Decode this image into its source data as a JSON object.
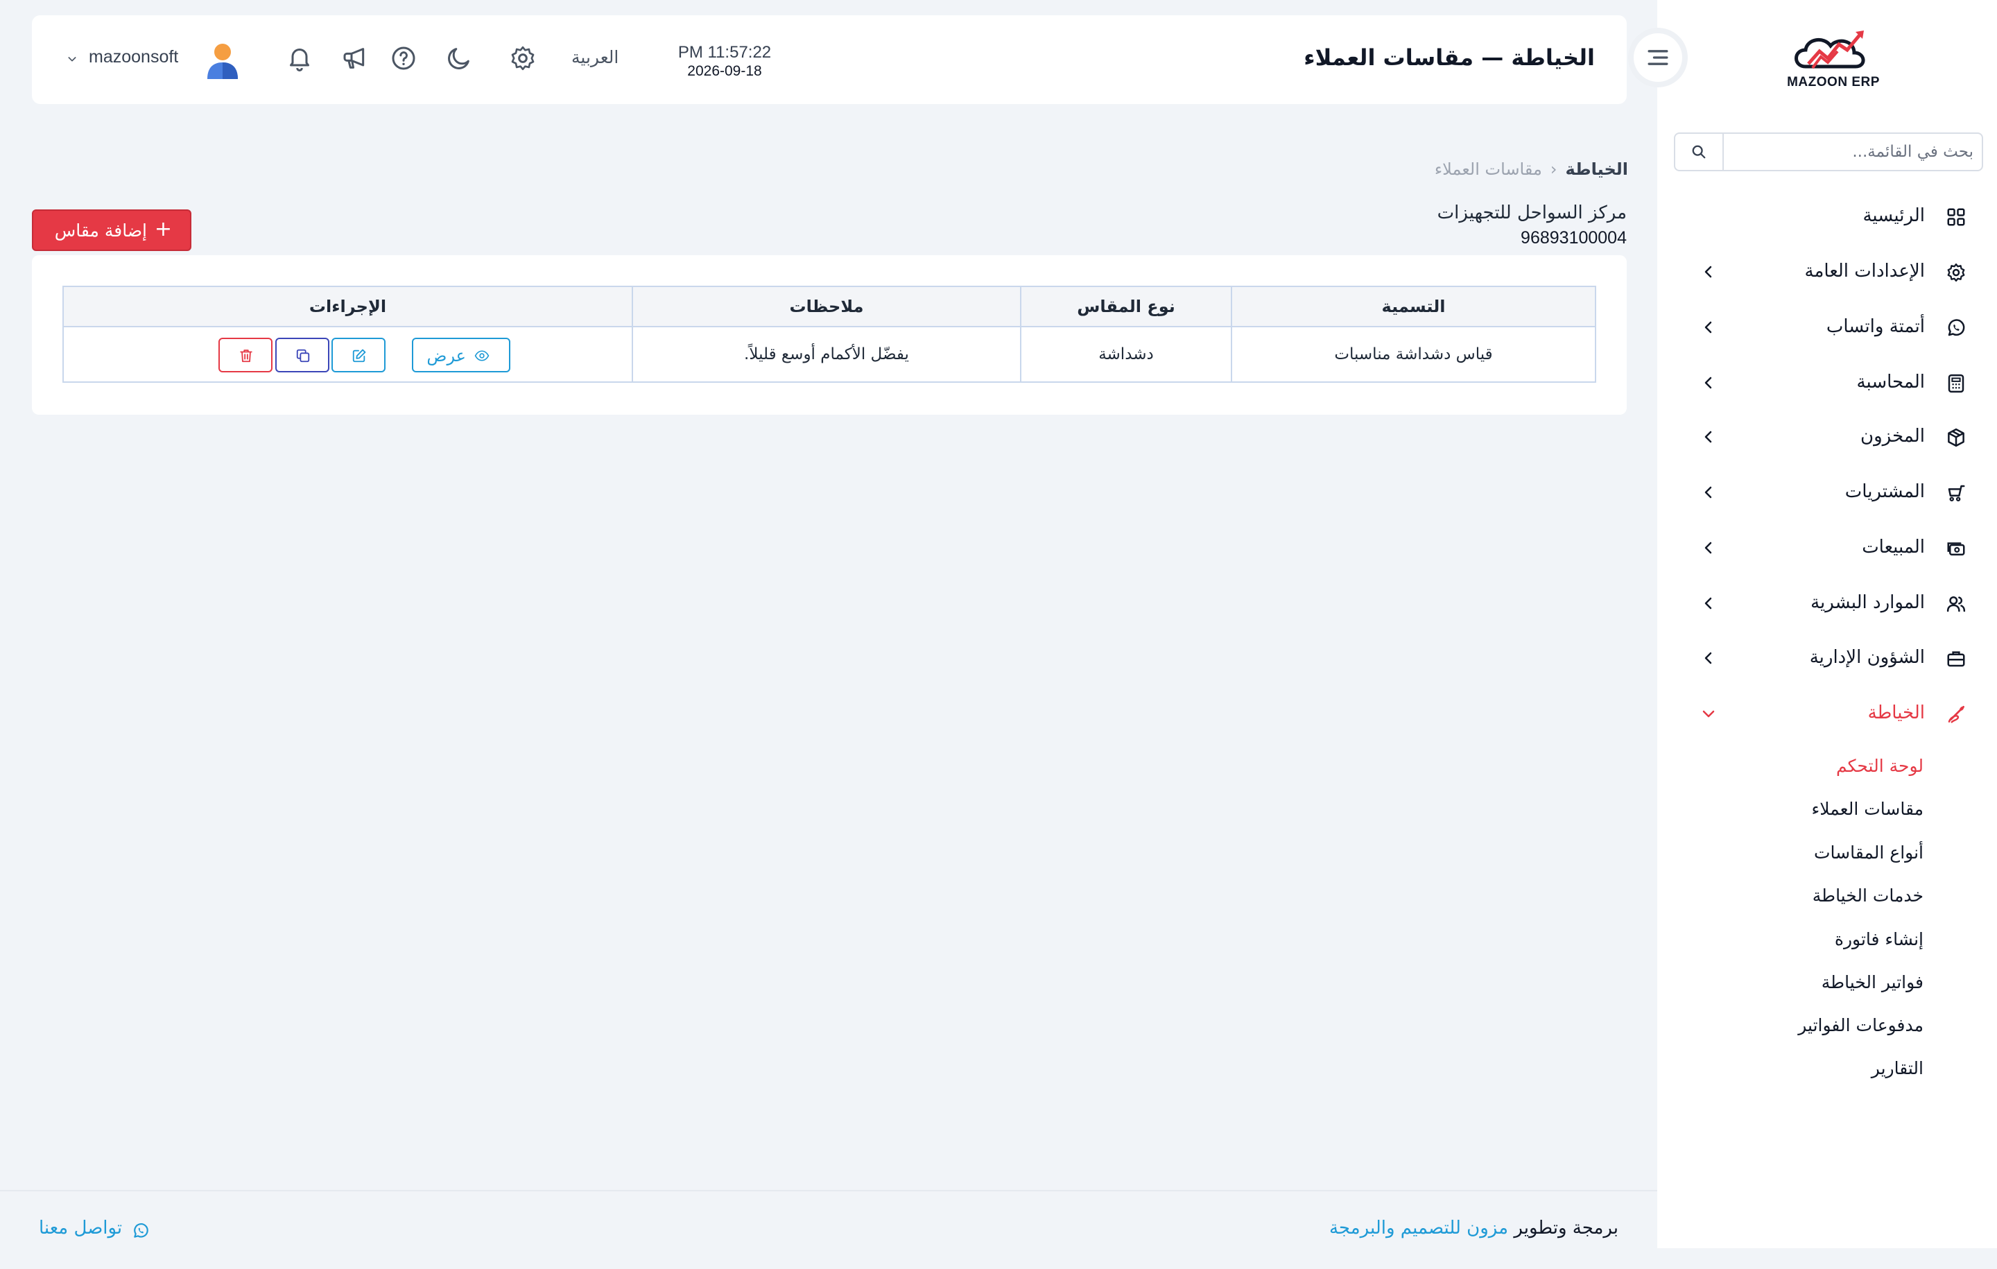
{
  "app": {
    "logo_text": "MAZOON ERP"
  },
  "sidebar": {
    "search_placeholder": "بحث في القائمة...",
    "items": [
      {
        "label": "الرئيسية",
        "icon": "grid-icon",
        "chevron": false
      },
      {
        "label": "الإعدادات العامة",
        "icon": "gear-icon",
        "chevron": true
      },
      {
        "label": "أتمتة واتساب",
        "icon": "whatsapp-icon",
        "chevron": true
      },
      {
        "label": "المحاسبة",
        "icon": "calculator-icon",
        "chevron": true
      },
      {
        "label": "المخزون",
        "icon": "box-icon",
        "chevron": true
      },
      {
        "label": "المشتريات",
        "icon": "cart-icon",
        "chevron": true
      },
      {
        "label": "المبيعات",
        "icon": "cash-icon",
        "chevron": true
      },
      {
        "label": "الموارد البشرية",
        "icon": "users-icon",
        "chevron": true
      },
      {
        "label": "الشؤون الإدارية",
        "icon": "briefcase-icon",
        "chevron": true
      },
      {
        "label": "الخياطة",
        "icon": "needle-icon",
        "chevron": true,
        "expanded": true,
        "active": true
      }
    ],
    "submenu": [
      {
        "label": "لوحة التحكم",
        "active": true
      },
      {
        "label": "مقاسات العملاء"
      },
      {
        "label": "أنواع المقاسات"
      },
      {
        "label": "خدمات الخياطة"
      },
      {
        "label": "إنشاء فاتورة"
      },
      {
        "label": "فواتير الخياطة"
      },
      {
        "label": "مدفوعات الفواتير"
      },
      {
        "label": "التقارير"
      }
    ]
  },
  "header": {
    "title": "الخياطة — مقاسات العملاء",
    "time": "PM 11:57:22",
    "date": "2026-09-18",
    "language": "العربية",
    "username": "mazoonsoft"
  },
  "breadcrumb": {
    "root": "الخياطة",
    "current": "مقاسات العملاء"
  },
  "company": {
    "name": "مركز السواحل للتجهيزات",
    "phone": "96893100004"
  },
  "actions": {
    "add_label": "إضافة مقاس"
  },
  "table": {
    "headers": [
      "التسمية",
      "نوع المقاس",
      "ملاحظات",
      "الإجراءات"
    ],
    "rows": [
      {
        "name": "قياس دشداشة مناسبات",
        "type": "دشداشة",
        "notes": "يفضّل الأكمام أوسع قليلاً.",
        "view_label": "عرض"
      }
    ]
  },
  "footer": {
    "credit_prefix": "برمجة وتطوير",
    "credit_brand": "مزون للتصميم والبرمجة",
    "contact": "تواصل معنا"
  },
  "colors": {
    "accent": "#e53945",
    "link": "#1e9ad6",
    "background": "#f1f4f8"
  }
}
